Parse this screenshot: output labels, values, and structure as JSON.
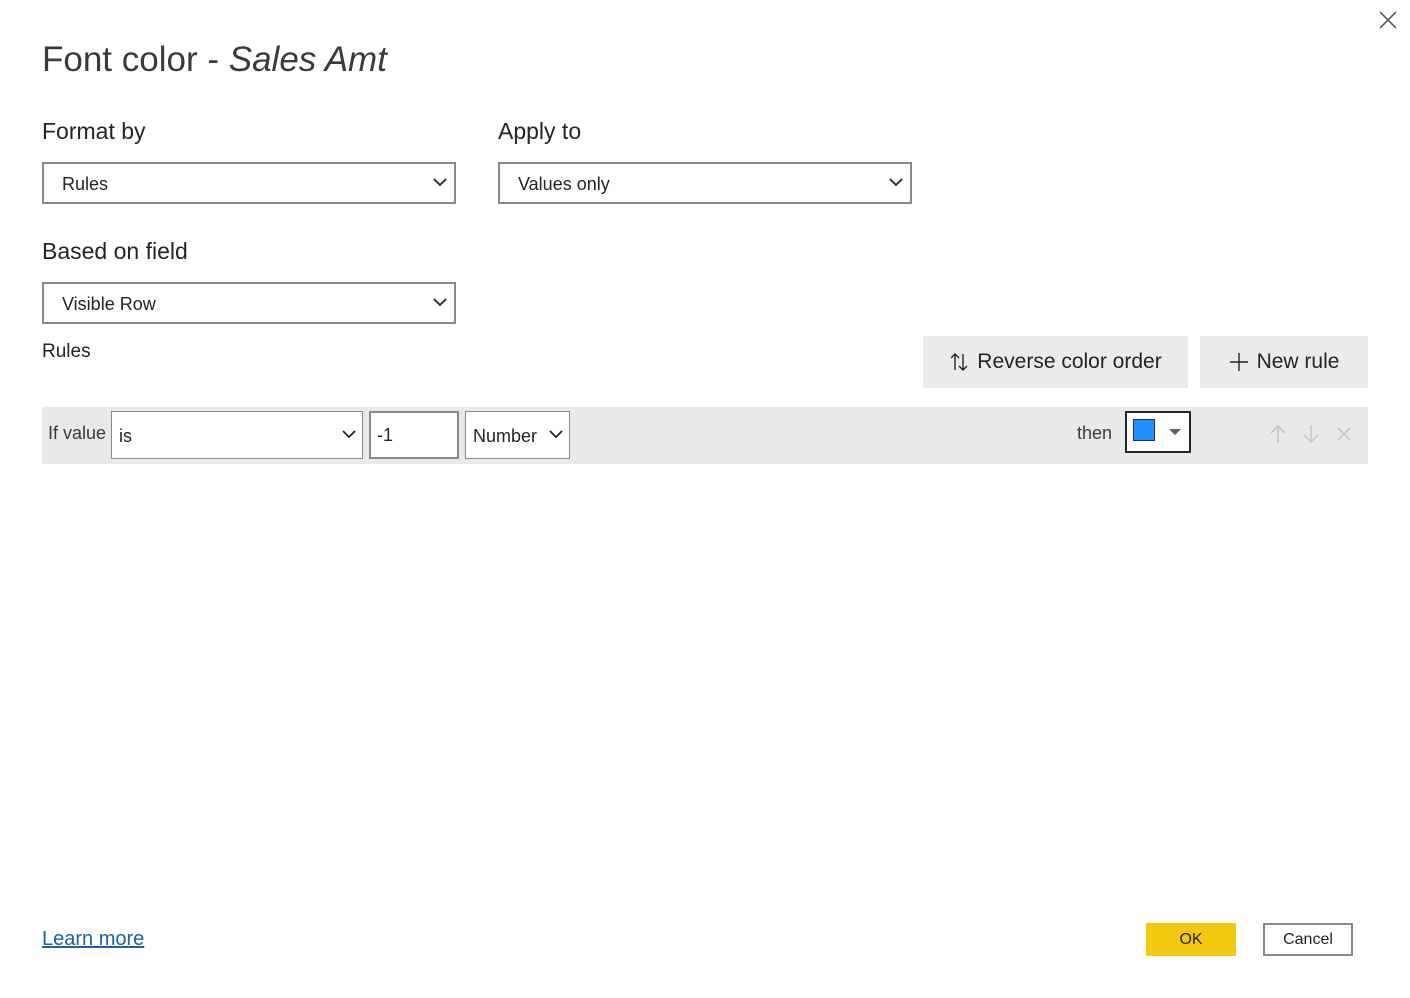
{
  "dialog": {
    "title_prefix": "Font color - ",
    "title_field": "Sales Amt",
    "close_icon": "close-icon"
  },
  "format_by": {
    "label": "Format by",
    "selected": "Rules"
  },
  "apply_to": {
    "label": "Apply to",
    "selected": "Values only"
  },
  "based_on_field": {
    "label": "Based on field",
    "selected": "Visible Row"
  },
  "rules": {
    "label": "Rules",
    "reverse_button": {
      "label": "Reverse color order",
      "icon": "sort-arrows-icon"
    },
    "new_rule_button": {
      "label": "New rule",
      "icon": "plus-icon"
    },
    "items": [
      {
        "if_label": "If value",
        "operator": "is",
        "value": "-1",
        "value_type": "Number",
        "then_label": "then",
        "color": "#1e90ff",
        "actions": [
          "arrow-up-icon",
          "arrow-down-icon",
          "delete-icon"
        ]
      }
    ]
  },
  "footer": {
    "learn_more": "Learn more",
    "ok": "OK",
    "cancel": "Cancel"
  },
  "colors": {
    "accent": "#f2c811",
    "link": "#1f5fa8",
    "row_bg": "#e9e9e9"
  }
}
